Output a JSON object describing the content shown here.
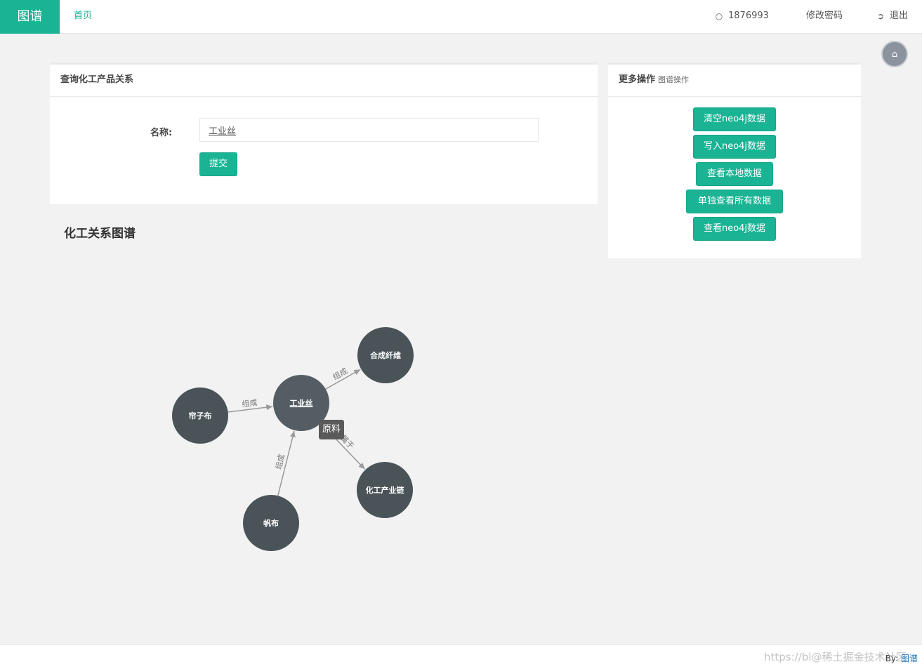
{
  "header": {
    "brand": "图谱",
    "nav_home": "首页",
    "user": "1876993",
    "change_password": "修改密码",
    "logout": "退出"
  },
  "query_panel": {
    "title": "查询化工产品关系",
    "name_label": "名称:",
    "name_value": "工业丝",
    "submit": "提交"
  },
  "ops_panel": {
    "title": "更多操作",
    "subtitle": "图谱操作",
    "buttons": [
      "清空neo4j数据",
      "写入neo4j数据",
      "查看本地数据",
      "单独查看所有数据",
      "查看neo4j数据"
    ]
  },
  "graph": {
    "title": "化工关系图谱",
    "tooltip": "原料",
    "nodes": [
      {
        "id": "center",
        "label": "工业丝"
      },
      {
        "id": "n1",
        "label": "合成纤维"
      },
      {
        "id": "n2",
        "label": "帘子布"
      },
      {
        "id": "n3",
        "label": "化工产业链"
      },
      {
        "id": "n4",
        "label": "帆布"
      }
    ],
    "edges": [
      {
        "from": "center",
        "to": "n1",
        "label": "组成"
      },
      {
        "from": "n2",
        "to": "center",
        "label": "组成"
      },
      {
        "from": "center",
        "to": "n3",
        "label": "属于"
      },
      {
        "from": "n4",
        "to": "center",
        "label": "组成"
      }
    ],
    "colors": {
      "node": "#4a5358",
      "center": "#535d63",
      "edge": "#9a9a9a"
    }
  },
  "footer": {
    "by_label": "By:",
    "by_link": "图谱",
    "watermark": "https://bl@稀土掘金技术社区"
  }
}
